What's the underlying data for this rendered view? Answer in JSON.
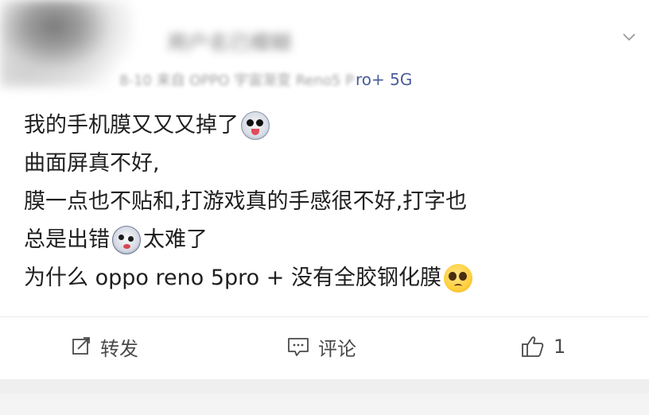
{
  "header": {
    "username_blurred": "用户名已模糊",
    "meta_blurred": "8-10 来自 OPPO 宇宙渐变 Reno5 P",
    "meta_visible": "ro+ 5G",
    "menu_icon": "chevron-down-icon"
  },
  "post": {
    "line1": "我的手机膜又又又掉了",
    "line2": "曲面屏真不好,",
    "line3": "膜一点也不贴和,打游戏真的手感很不好,打字也",
    "line4a": "总是出错",
    "line4b": "太难了",
    "line5": "为什么 oppo reno 5pro + 没有全胶钢化膜",
    "emojis": [
      "crazy-face-emoji",
      "sweat-face-emoji",
      "pleading-face-emoji"
    ]
  },
  "actions": {
    "repost_label": "转发",
    "comment_label": "评论",
    "like_count": "1"
  },
  "colors": {
    "meta_link": "#4a5e99",
    "text": "#1f1f1f",
    "action_text": "#4a4a4a",
    "footer_bg": "#efefef"
  }
}
